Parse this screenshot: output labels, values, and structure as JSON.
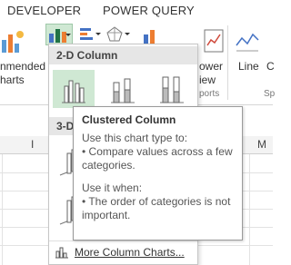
{
  "tabs": [
    {
      "label": "DEVELOPER"
    },
    {
      "label": "POWER QUERY"
    }
  ],
  "ribbon": {
    "recommended_line1": "nmended",
    "recommended_line2": "harts",
    "power_view_line1": "ower",
    "power_view_line2": "iew",
    "reports_group": "ports",
    "line_label": "Line",
    "column_label": "C",
    "sparklines_group": "Sp"
  },
  "sheet": {
    "col_i": "I",
    "col_m": "M"
  },
  "dropdown": {
    "section_2d": "2-D Column",
    "section_3d": "3-D",
    "thumbs_2d": [
      {
        "icon": "clustered-column-icon",
        "selected": true
      },
      {
        "icon": "stacked-column-icon",
        "selected": false
      },
      {
        "icon": "100-stacked-column-icon",
        "selected": false
      }
    ],
    "more_label": "More Column Charts..."
  },
  "tooltip": {
    "title": "Clustered Column",
    "use_to_heading": "Use this chart type to:",
    "use_to_bullet": "• Compare values across a few categories.",
    "use_when_heading": "Use it when:",
    "use_when_bullet": "• The order of categories is not important."
  },
  "colors": {
    "selected_bg": "#cfe8d3",
    "accent_green": "#217346",
    "section_bg": "#e6e6e6"
  }
}
